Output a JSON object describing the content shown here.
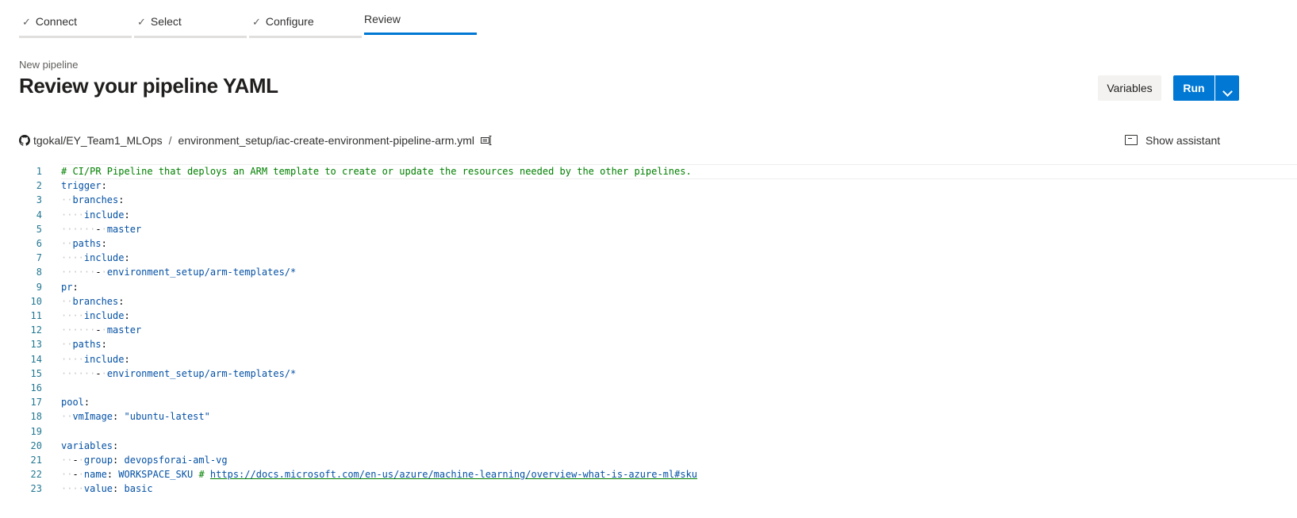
{
  "steps": [
    {
      "label": "Connect",
      "done": true
    },
    {
      "label": "Select",
      "done": true
    },
    {
      "label": "Configure",
      "done": true
    },
    {
      "label": "Review",
      "done": false,
      "active": true
    }
  ],
  "header": {
    "subtitle": "New pipeline",
    "title": "Review your pipeline YAML",
    "variables_label": "Variables",
    "run_label": "Run"
  },
  "path": {
    "repo": "tgokal/EY_Team1_MLOps",
    "separator": "/",
    "file": "environment_setup/iac-create-environment-pipeline-arm.yml"
  },
  "assistant_label": "Show assistant",
  "colors": {
    "accent": "#0078d4",
    "comment": "#008000",
    "line_number": "#237893"
  },
  "code_lines": [
    {
      "n": "1",
      "text": "# CI/PR Pipeline that deploys an ARM template to create or update the resources needed by the other pipelines."
    },
    {
      "n": "2",
      "text": "trigger:"
    },
    {
      "n": "3",
      "text": "  branches:"
    },
    {
      "n": "4",
      "text": "    include:"
    },
    {
      "n": "5",
      "text": "      - master"
    },
    {
      "n": "6",
      "text": "  paths:"
    },
    {
      "n": "7",
      "text": "    include:"
    },
    {
      "n": "8",
      "text": "      - environment_setup/arm-templates/*"
    },
    {
      "n": "9",
      "text": "pr:"
    },
    {
      "n": "10",
      "text": "  branches:"
    },
    {
      "n": "11",
      "text": "    include:"
    },
    {
      "n": "12",
      "text": "      - master"
    },
    {
      "n": "13",
      "text": "  paths:"
    },
    {
      "n": "14",
      "text": "    include:"
    },
    {
      "n": "15",
      "text": "      - environment_setup/arm-templates/*"
    },
    {
      "n": "16",
      "text": ""
    },
    {
      "n": "17",
      "text": "pool:"
    },
    {
      "n": "18",
      "text": "  vmImage: \"ubuntu-latest\""
    },
    {
      "n": "19",
      "text": ""
    },
    {
      "n": "20",
      "text": "variables:"
    },
    {
      "n": "21",
      "text": "  - group: devopsforai-aml-vg"
    },
    {
      "n": "22",
      "text": "  - name: WORKSPACE_SKU # https://docs.microsoft.com/en-us/azure/machine-learning/overview-what-is-azure-ml#sku"
    },
    {
      "n": "23",
      "text": "    value: basic"
    }
  ]
}
